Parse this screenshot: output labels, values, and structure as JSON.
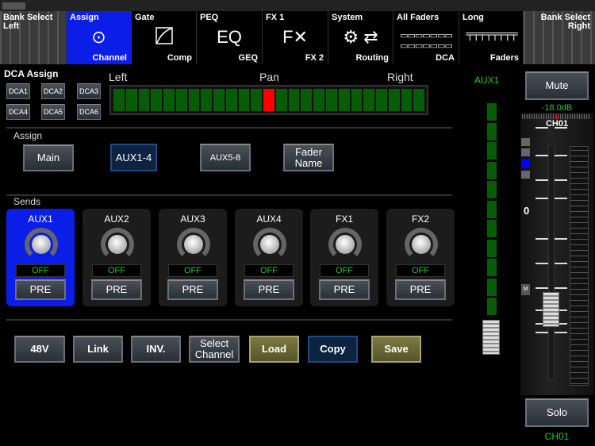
{
  "tabs": [
    {
      "top": "Bank Select Left",
      "bottom": ""
    },
    {
      "top": "Assign",
      "bottom": "Channel",
      "icon": "xlr-icon"
    },
    {
      "top": "Gate",
      "bottom": "Comp",
      "icon": "compressor-curve-icon"
    },
    {
      "top": "PEQ",
      "bottom": "GEQ",
      "icon_text": "EQ"
    },
    {
      "top": "FX 1",
      "bottom": "FX 2",
      "icon": "fx-icon"
    },
    {
      "top": "System",
      "bottom": "Routing",
      "icon": "gear-routing-icon"
    },
    {
      "top": "All Faders",
      "bottom": "DCA",
      "icon": "faders-grid-icon"
    },
    {
      "top": "Long",
      "bottom": "Faders",
      "icon": "long-faders-icon"
    },
    {
      "top": "Bank Select Right",
      "bottom": ""
    }
  ],
  "dca": {
    "title": "DCA Assign",
    "buttons": [
      "DCA1",
      "DCA2",
      "DCA3",
      "DCA4",
      "DCA5",
      "DCA6"
    ]
  },
  "pan": {
    "left": "Left",
    "center": "Pan",
    "right": "Right",
    "segments": 25,
    "position_index": 12
  },
  "assign": {
    "title": "Assign",
    "buttons": [
      "Main",
      "AUX1-4",
      "AUX5-8",
      "Fader Name"
    ],
    "selected": "AUX1-4"
  },
  "sends": {
    "title": "Sends",
    "items": [
      {
        "name": "AUX1",
        "value": "OFF",
        "mode": "PRE"
      },
      {
        "name": "AUX2",
        "value": "OFF",
        "mode": "PRE"
      },
      {
        "name": "AUX3",
        "value": "OFF",
        "mode": "PRE"
      },
      {
        "name": "AUX4",
        "value": "OFF",
        "mode": "PRE"
      },
      {
        "name": "FX1",
        "value": "OFF",
        "mode": "PRE"
      },
      {
        "name": "FX2",
        "value": "OFF",
        "mode": "PRE"
      }
    ],
    "selected": "AUX1"
  },
  "bottom": {
    "b48v": "48V",
    "link": "Link",
    "inv": "INV.",
    "select_channel": "Select Channel",
    "load": "Load",
    "copy": "Copy",
    "save": "Save"
  },
  "aux_meter": {
    "label": "AUX1"
  },
  "channel": {
    "mute": "Mute",
    "gain": "-18.0dB",
    "name": "CH01",
    "zero": "0",
    "m": "M",
    "solo": "Solo",
    "footer": "CH01"
  },
  "colors": {
    "selected": "#0a1ee8",
    "meter_green": "#075c07",
    "pan_marker": "#ff0000",
    "label_green": "#22cc22"
  }
}
